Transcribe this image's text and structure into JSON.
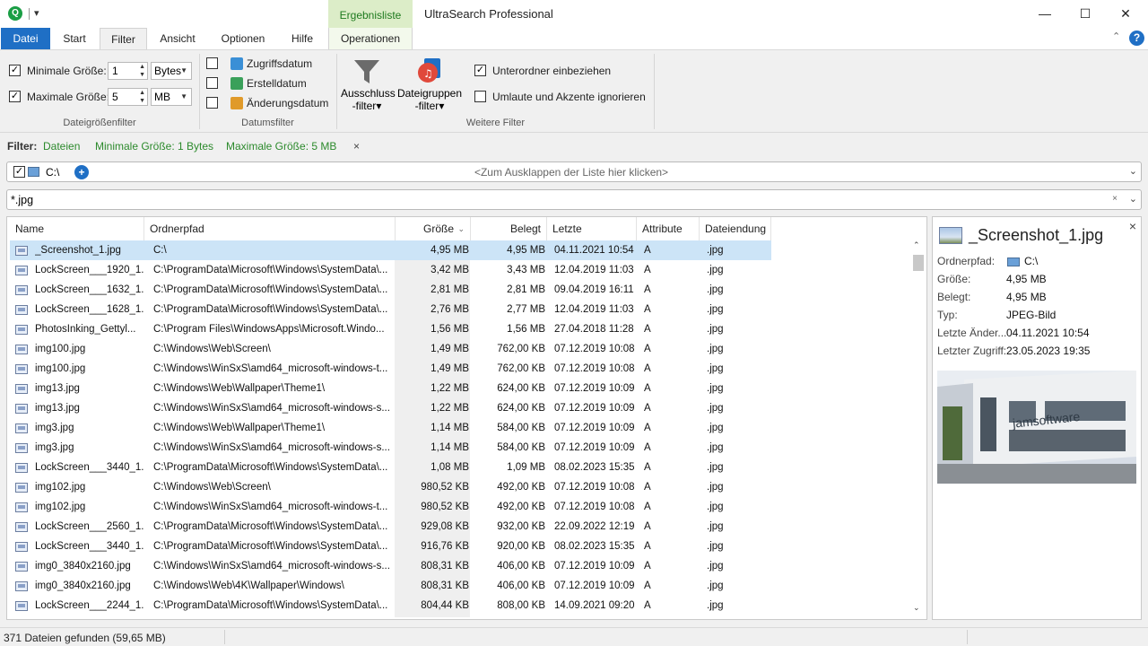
{
  "app": {
    "title": "UltraSearch Professional",
    "context_tab_header": "Ergebnisliste"
  },
  "ribbon_tabs": [
    "Datei",
    "Start",
    "Filter",
    "Ansicht",
    "Optionen",
    "Hilfe",
    "Operationen"
  ],
  "ribbon": {
    "size_filter": {
      "min_label": "Minimale Größe:",
      "min_value": "1",
      "min_unit": "Bytes",
      "max_label": "Maximale Größe:",
      "max_value": "5",
      "max_unit": "MB",
      "group_label": "Dateigrößenfilter"
    },
    "date_filter": {
      "access_label": "Zugriffsdatum",
      "created_label": "Erstelldatum",
      "modified_label": "Änderungsdatum",
      "group_label": "Datumsfilter"
    },
    "other_filter": {
      "exclude_l1": "Ausschluss",
      "exclude_l2": "-filter",
      "filegroup_l1": "Dateigruppen",
      "filegroup_l2": "-filter",
      "subfolders_label": "Unterordner einbeziehen",
      "umlauts_label": "Umlaute und Akzente ignorieren",
      "group_label": "Weitere Filter"
    }
  },
  "filter_line": {
    "prefix": "Filter:",
    "f1": "Dateien",
    "f2": "Minimale Größe: 1 Bytes",
    "f3": "Maximale Größe: 5 MB",
    "close": "×"
  },
  "location": {
    "path": "C:\\",
    "expand_hint": "<Zum Ausklappen der Liste hier klicken>"
  },
  "search": {
    "query": "*.jpg"
  },
  "columns": {
    "name": "Name",
    "path": "Ordnerpfad",
    "size": "Größe",
    "used": "Belegt",
    "modified": "Letzte Änderung",
    "attr": "Attribute",
    "ext": "Dateiendung"
  },
  "rows": [
    {
      "name": "_Screenshot_1.jpg",
      "path": "C:\\",
      "size": "4,95 MB",
      "used": "4,95 MB",
      "modified": "04.11.2021 10:54",
      "attr": "A",
      "ext": ".jpg"
    },
    {
      "name": "LockScreen___1920_1...",
      "path": "C:\\ProgramData\\Microsoft\\Windows\\SystemData\\...",
      "size": "3,42 MB",
      "used": "3,43 MB",
      "modified": "12.04.2019 11:03",
      "attr": "A",
      "ext": ".jpg"
    },
    {
      "name": "LockScreen___1632_1...",
      "path": "C:\\ProgramData\\Microsoft\\Windows\\SystemData\\...",
      "size": "2,81 MB",
      "used": "2,81 MB",
      "modified": "09.04.2019 16:11",
      "attr": "A",
      "ext": ".jpg"
    },
    {
      "name": "LockScreen___1628_1...",
      "path": "C:\\ProgramData\\Microsoft\\Windows\\SystemData\\...",
      "size": "2,76 MB",
      "used": "2,77 MB",
      "modified": "12.04.2019 11:03",
      "attr": "A",
      "ext": ".jpg"
    },
    {
      "name": "PhotosInking_Gettyl...",
      "path": "C:\\Program Files\\WindowsApps\\Microsoft.Windo...",
      "size": "1,56 MB",
      "used": "1,56 MB",
      "modified": "27.04.2018 11:28",
      "attr": "A",
      "ext": ".jpg"
    },
    {
      "name": "img100.jpg",
      "path": "C:\\Windows\\Web\\Screen\\",
      "size": "1,49 MB",
      "used": "762,00 KB",
      "modified": "07.12.2019 10:08",
      "attr": "A",
      "ext": ".jpg"
    },
    {
      "name": "img100.jpg",
      "path": "C:\\Windows\\WinSxS\\amd64_microsoft-windows-t...",
      "size": "1,49 MB",
      "used": "762,00 KB",
      "modified": "07.12.2019 10:08",
      "attr": "A",
      "ext": ".jpg"
    },
    {
      "name": "img13.jpg",
      "path": "C:\\Windows\\Web\\Wallpaper\\Theme1\\",
      "size": "1,22 MB",
      "used": "624,00 KB",
      "modified": "07.12.2019 10:09",
      "attr": "A",
      "ext": ".jpg"
    },
    {
      "name": "img13.jpg",
      "path": "C:\\Windows\\WinSxS\\amd64_microsoft-windows-s...",
      "size": "1,22 MB",
      "used": "624,00 KB",
      "modified": "07.12.2019 10:09",
      "attr": "A",
      "ext": ".jpg"
    },
    {
      "name": "img3.jpg",
      "path": "C:\\Windows\\Web\\Wallpaper\\Theme1\\",
      "size": "1,14 MB",
      "used": "584,00 KB",
      "modified": "07.12.2019 10:09",
      "attr": "A",
      "ext": ".jpg"
    },
    {
      "name": "img3.jpg",
      "path": "C:\\Windows\\WinSxS\\amd64_microsoft-windows-s...",
      "size": "1,14 MB",
      "used": "584,00 KB",
      "modified": "07.12.2019 10:09",
      "attr": "A",
      "ext": ".jpg"
    },
    {
      "name": "LockScreen___3440_1...",
      "path": "C:\\ProgramData\\Microsoft\\Windows\\SystemData\\...",
      "size": "1,08 MB",
      "used": "1,09 MB",
      "modified": "08.02.2023 15:35",
      "attr": "A",
      "ext": ".jpg"
    },
    {
      "name": "img102.jpg",
      "path": "C:\\Windows\\Web\\Screen\\",
      "size": "980,52 KB",
      "used": "492,00 KB",
      "modified": "07.12.2019 10:08",
      "attr": "A",
      "ext": ".jpg"
    },
    {
      "name": "img102.jpg",
      "path": "C:\\Windows\\WinSxS\\amd64_microsoft-windows-t...",
      "size": "980,52 KB",
      "used": "492,00 KB",
      "modified": "07.12.2019 10:08",
      "attr": "A",
      "ext": ".jpg"
    },
    {
      "name": "LockScreen___2560_1...",
      "path": "C:\\ProgramData\\Microsoft\\Windows\\SystemData\\...",
      "size": "929,08 KB",
      "used": "932,00 KB",
      "modified": "22.09.2022 12:19",
      "attr": "A",
      "ext": ".jpg"
    },
    {
      "name": "LockScreen___3440_1...",
      "path": "C:\\ProgramData\\Microsoft\\Windows\\SystemData\\...",
      "size": "916,76 KB",
      "used": "920,00 KB",
      "modified": "08.02.2023 15:35",
      "attr": "A",
      "ext": ".jpg"
    },
    {
      "name": "img0_3840x2160.jpg",
      "path": "C:\\Windows\\WinSxS\\amd64_microsoft-windows-s...",
      "size": "808,31 KB",
      "used": "406,00 KB",
      "modified": "07.12.2019 10:09",
      "attr": "A",
      "ext": ".jpg"
    },
    {
      "name": "img0_3840x2160.jpg",
      "path": "C:\\Windows\\Web\\4K\\Wallpaper\\Windows\\",
      "size": "808,31 KB",
      "used": "406,00 KB",
      "modified": "07.12.2019 10:09",
      "attr": "A",
      "ext": ".jpg"
    },
    {
      "name": "LockScreen___2244_1...",
      "path": "C:\\ProgramData\\Microsoft\\Windows\\SystemData\\...",
      "size": "804,44 KB",
      "used": "808,00 KB",
      "modified": "14.09.2021 09:20",
      "attr": "A",
      "ext": ".jpg"
    }
  ],
  "details": {
    "title": "_Screenshot_1.jpg",
    "folder_label": "Ordnerpfad:",
    "folder_value": "C:\\",
    "size_label": "Größe:",
    "size_value": "4,95 MB",
    "used_label": "Belegt:",
    "used_value": "4,95 MB",
    "type_label": "Typ:",
    "type_value": "JPEG-Bild",
    "modified_label": "Letzte Änder...",
    "modified_value": "04.11.2021 10:54",
    "accessed_label": "Letzter Zugriff:",
    "accessed_value": "23.05.2023 19:35",
    "preview_text": "jamsoftware"
  },
  "status": {
    "text": "371 Dateien gefunden (59,65 MB)"
  },
  "colors": {
    "accent_blue": "#1f6fc5",
    "filter_green": "#2c8a2c",
    "context_green": "#dcedc8",
    "selection": "#cce4f7"
  }
}
